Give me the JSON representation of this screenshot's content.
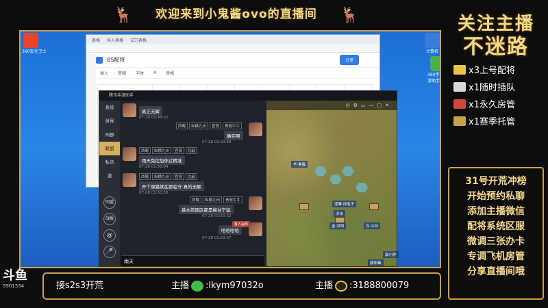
{
  "banner": {
    "title": "欢迎来到小鬼酱ovo的直播间"
  },
  "sheet": {
    "tab_1": "表格",
    "tab_2": "导入表格",
    "tab_3": "试刀表格",
    "doc_title": "BS配将",
    "share_label": "分享",
    "toolbar": [
      "插入",
      "审阅",
      "字体",
      "A",
      "表格"
    ]
  },
  "chat": {
    "window_title": "腾讯手游助手",
    "sidebar": [
      "系统",
      "世界",
      "州郡",
      "联盟",
      "私信",
      "谱"
    ],
    "sidebar_icons": [
      "同盟",
      "战报"
    ],
    "messages": [
      {
        "side": "left",
        "text": "真正无解",
        "ts": "07-28 01:49:52"
      },
      {
        "side": "right",
        "tags": [
          "西蜀",
          "纵横九州",
          "官员",
          "青敖牛牛"
        ],
        "text": "确实啊",
        "ts": "07-28 01:49:58"
      },
      {
        "side": "left",
        "tags": [
          "西蜀",
          "纵横九州",
          "官员",
          "北敌"
        ],
        "text": "雨天免控加休辽精准",
        "ts": "07-28 01:50:04"
      },
      {
        "side": "left",
        "tags": [
          "西蜀",
          "纵横九州",
          "官员",
          "北敌"
        ],
        "text": "开个课路就在那驻守 真的无解",
        "ts": "07-28 01:50:30"
      },
      {
        "side": "right",
        "tags": [
          "西蜀",
          "纵横九州",
          "青敖牛牛"
        ],
        "text": "基本前面区都是换甘宁猛",
        "ts": "07-28 01:50:32"
      },
      {
        "side": "right",
        "text": "哈哈哈哈",
        "ts": "07-28 01:50:37"
      }
    ],
    "input_value": "雨天",
    "status_text": "有人@你"
  },
  "game": {
    "labels": [
      "华·鲁雍",
      "漆寨·邱毛子",
      "涉水",
      "金·汉阳",
      "汉·公孙",
      "康阳雍",
      "康小胖"
    ]
  },
  "right": {
    "title_1": "关注主播",
    "title_2": "不迷路",
    "benefits": [
      "x3上号配将",
      "x1随时插队",
      "x1永久房管",
      "x1赛季托管"
    ],
    "promo": [
      "31号开荒冲榜",
      "开始预约私聊",
      "添加主播微信",
      "配将系统区服",
      "微调三张办卡",
      "专调飞机房管",
      "分享直播间哦"
    ]
  },
  "bottom": {
    "item_1": "接s2s3开荒",
    "wechat_prefix": "主播",
    "wechat_id": ":lkym97032o",
    "qq_prefix": "主播",
    "qq_id": ":3188800079"
  },
  "logo": {
    "big": "斗鱼",
    "small": "5901534"
  },
  "desktop": {
    "label_1": "360安全卫士",
    "label_2": "计算机",
    "label_3": "360手游助手"
  }
}
